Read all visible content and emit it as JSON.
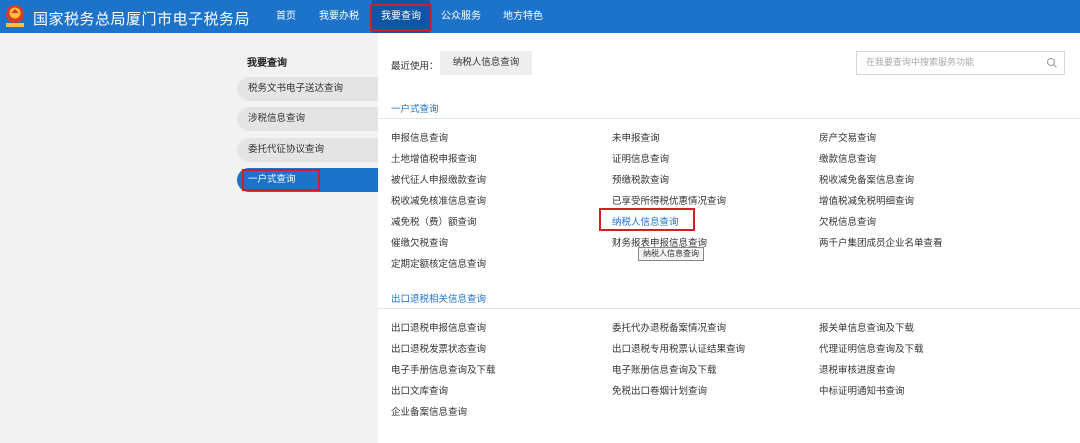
{
  "header": {
    "title": "国家税务总局厦门市电子税务局",
    "nav": [
      {
        "label": "首页"
      },
      {
        "label": "我要办税"
      },
      {
        "label": "我要查询"
      },
      {
        "label": "公众服务"
      },
      {
        "label": "地方特色"
      }
    ]
  },
  "sidebar": {
    "title": "我要查询",
    "items": [
      {
        "label": "税务文书电子送达查询"
      },
      {
        "label": "涉税信息查询"
      },
      {
        "label": "委托代征协议查询"
      },
      {
        "label": "一户式查询"
      }
    ]
  },
  "recent": {
    "label": "最近使用：",
    "tag": "纳税人信息查询"
  },
  "search": {
    "placeholder": "在我要查询中搜索服务功能"
  },
  "sections": [
    {
      "title": "一户式查询",
      "items": [
        "申报信息查询",
        "未申报查询",
        "房产交易查询",
        "土地增值税申报查询",
        "证明信息查询",
        "缴款信息查询",
        "被代征人申报缴款查询",
        "预缴税款查询",
        "税收减免备案信息查询",
        "税收减免核准信息查询",
        "已享受所得税优惠情况查询",
        "增值税减免税明细查询",
        "减免税（费）额查询",
        "纳税人信息查询",
        "欠税信息查询",
        "催缴欠税查询",
        "财务报表申报信息查询",
        "两千户集团成员企业名单查看",
        "定期定额核定信息查询"
      ]
    },
    {
      "title": "出口退税相关信息查询",
      "items": [
        "出口退税申报信息查询",
        "委托代办退税备案情况查询",
        "报关单信息查询及下载",
        "出口退税发票状态查询",
        "出口退税专用税票认证结果查询",
        "代理证明信息查询及下载",
        "电子手册信息查询及下载",
        "电子账册信息查询及下载",
        "退税审核进度查询",
        "出口文库查询",
        "免税出口卷烟计划查询",
        "中标证明通知书查询",
        "企业备案信息查询"
      ]
    }
  ],
  "tooltip": "纳税人信息查询",
  "colors": {
    "brand_blue": "#1d73c9",
    "nav_active": "#0f57a6",
    "highlight_red": "#d01f24"
  }
}
